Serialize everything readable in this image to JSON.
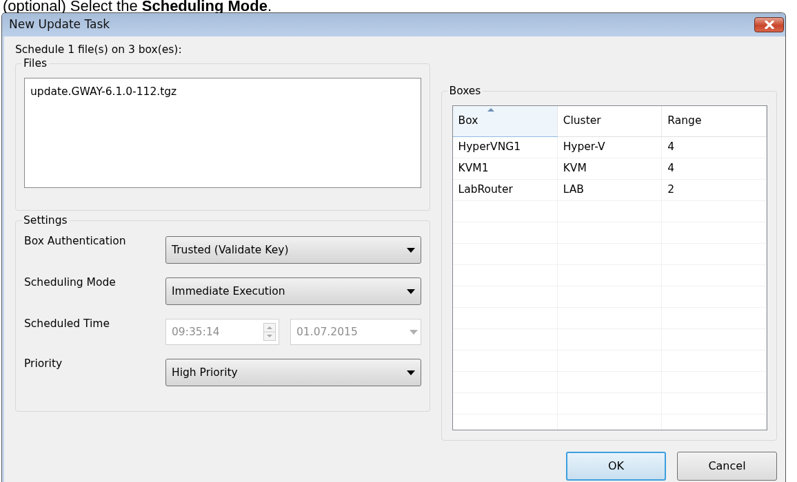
{
  "instruction": "(optional) Select the **Scheduling Mode**.",
  "window": {
    "title": "New Update Task"
  },
  "summary": "Schedule 1 file(s) on 3 box(es):",
  "files": {
    "title": "Files",
    "items": [
      "update.GWAY-6.1.0-112.tgz"
    ]
  },
  "settings": {
    "title": "Settings",
    "fields": [
      {
        "label": "Box Authentication",
        "kind": "dropdown",
        "value": "Trusted (Validate Key)",
        "disabled": false
      },
      {
        "label": "Scheduling Mode",
        "kind": "dropdown",
        "value": "Immediate Execution",
        "disabled": false
      },
      {
        "label": "Scheduled Time",
        "kind": "datetime",
        "time": "09:35:14",
        "date": "01.07.2015",
        "disabled": true
      },
      {
        "label": "Priority",
        "kind": "dropdown",
        "value": "High Priority",
        "disabled": false
      }
    ]
  },
  "boxes": {
    "title": "Boxes",
    "columns": [
      {
        "label": "Box",
        "sorted": true
      },
      {
        "label": "Cluster",
        "sorted": false
      },
      {
        "label": "Range",
        "sorted": false
      }
    ],
    "rows": [
      [
        "HyperVNG1",
        "Hyper-V",
        "4"
      ],
      [
        "KVM1",
        "KVM",
        "4"
      ],
      [
        "LabRouter",
        "LAB",
        "2"
      ]
    ]
  },
  "buttons": [
    {
      "label": "OK",
      "default": true
    },
    {
      "label": "Cancel",
      "default": false
    }
  ]
}
